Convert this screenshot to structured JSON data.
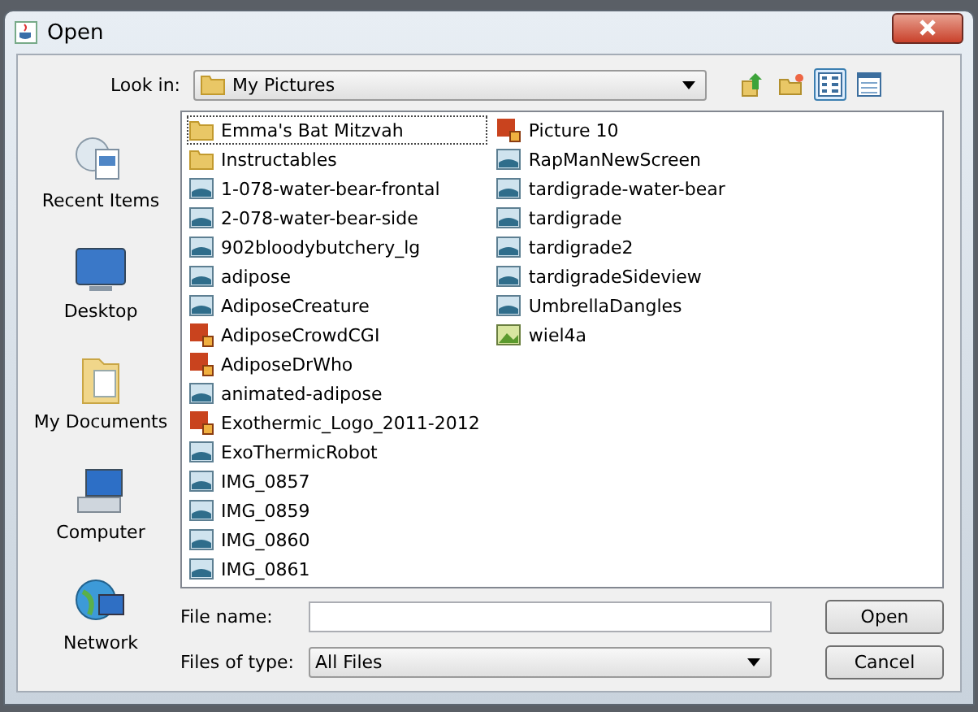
{
  "window": {
    "title": "Open"
  },
  "look_in": {
    "label": "Look in:",
    "value": "My Pictures"
  },
  "toolbar": [
    {
      "kind": "up",
      "selected": false
    },
    {
      "kind": "new-folder",
      "selected": false
    },
    {
      "kind": "list",
      "selected": true
    },
    {
      "kind": "details",
      "selected": false
    }
  ],
  "places": [
    {
      "kind": "recent",
      "label": "Recent Items"
    },
    {
      "kind": "desktop",
      "label": "Desktop"
    },
    {
      "kind": "documents",
      "label": "My Documents"
    },
    {
      "kind": "computer",
      "label": "Computer"
    },
    {
      "kind": "network",
      "label": "Network"
    }
  ],
  "files": [
    {
      "kind": "folder",
      "name": "Emma's Bat Mitzvah",
      "selected": true
    },
    {
      "kind": "folder",
      "name": "Instructables",
      "selected": false
    },
    {
      "kind": "image",
      "name": "1-078-water-bear-frontal",
      "selected": false
    },
    {
      "kind": "image",
      "name": "2-078-water-bear-side",
      "selected": false
    },
    {
      "kind": "image",
      "name": "902bloodybutchery_lg",
      "selected": false
    },
    {
      "kind": "image",
      "name": "adipose",
      "selected": false
    },
    {
      "kind": "image",
      "name": "AdiposeCreature",
      "selected": false
    },
    {
      "kind": "graphic",
      "name": "AdiposeCrowdCGI",
      "selected": false
    },
    {
      "kind": "graphic",
      "name": "AdiposeDrWho",
      "selected": false
    },
    {
      "kind": "image",
      "name": "animated-adipose",
      "selected": false
    },
    {
      "kind": "graphic",
      "name": "Exothermic_Logo_2011-2012",
      "selected": false
    },
    {
      "kind": "image",
      "name": "ExoThermicRobot",
      "selected": false
    },
    {
      "kind": "image",
      "name": "IMG_0857",
      "selected": false
    },
    {
      "kind": "image",
      "name": "IMG_0859",
      "selected": false
    },
    {
      "kind": "image",
      "name": "IMG_0860",
      "selected": false
    },
    {
      "kind": "image",
      "name": "IMG_0861",
      "selected": false
    },
    {
      "kind": "graphic",
      "name": "Picture 10",
      "selected": false
    },
    {
      "kind": "image",
      "name": "RapManNewScreen",
      "selected": false
    },
    {
      "kind": "image",
      "name": "tardigrade-water-bear",
      "selected": false
    },
    {
      "kind": "image",
      "name": "tardigrade",
      "selected": false
    },
    {
      "kind": "image",
      "name": "tardigrade2",
      "selected": false
    },
    {
      "kind": "image",
      "name": "tardigradeSideview",
      "selected": false
    },
    {
      "kind": "image",
      "name": "UmbrellaDangles",
      "selected": false
    },
    {
      "kind": "bitmap",
      "name": "wiel4a",
      "selected": false
    }
  ],
  "file_name": {
    "label": "File name:"
  },
  "file_type": {
    "label": "Files of type:",
    "value": "All Files"
  },
  "buttons": [
    "Open",
    "Cancel"
  ]
}
